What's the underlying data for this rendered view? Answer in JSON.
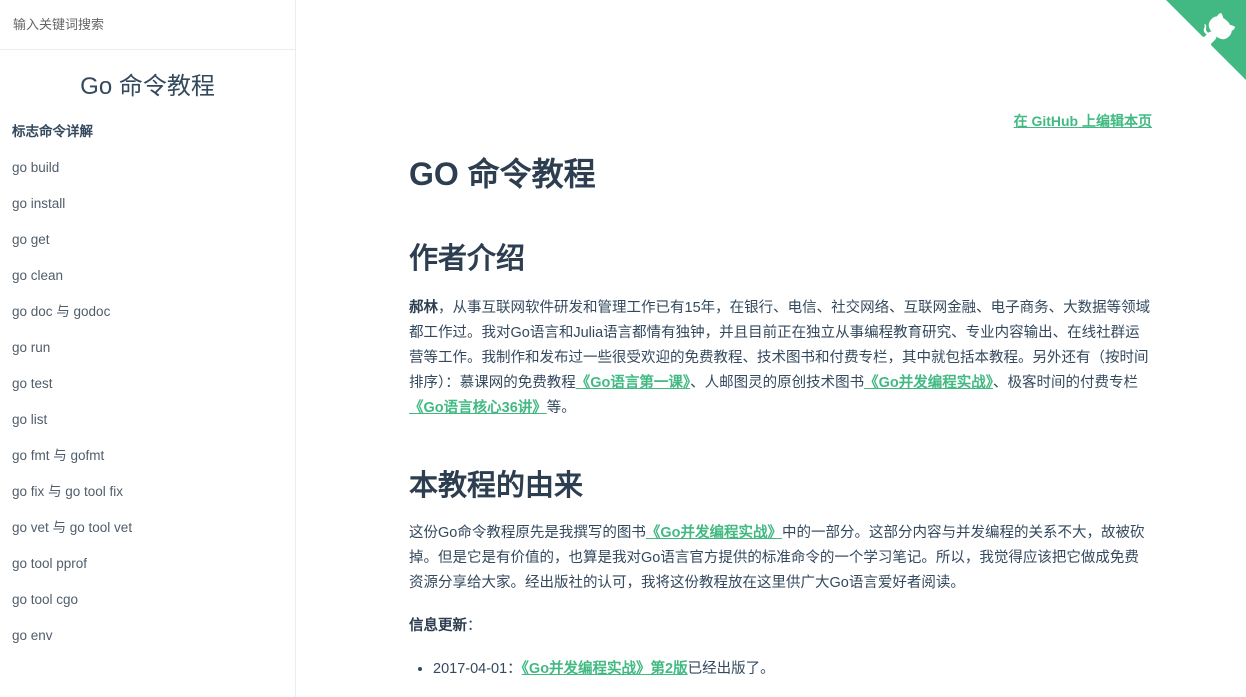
{
  "sidebar": {
    "search_placeholder": "输入关键词搜索",
    "app_name": "Go 命令教程",
    "items": [
      "标志命令详解",
      "go build",
      "go install",
      "go get",
      "go clean",
      "go doc 与 godoc",
      "go run",
      "go test",
      "go list",
      "go fmt 与 gofmt",
      "go fix 与 go tool fix",
      "go vet 与 go tool vet",
      "go tool pprof",
      "go tool cgo",
      "go env"
    ]
  },
  "corner": {
    "icon": "github-octocat-icon",
    "color": "#42b983"
  },
  "content": {
    "edit_link": "在 GitHub 上编辑本页",
    "title": "GO 命令教程",
    "section1": {
      "heading": "作者介绍",
      "author": "郝林",
      "p1_a": "，从事互联网软件研发和管理工作已有15年，在银行、电信、社交网络、互联网金融、电子商务、大数据等领域都工作过。我对Go语言和Julia语言都情有独钟，并且目前正在独立从事编程教育研究、专业内容输出、在线社群运营等工作。我制作和发布过一些很受欢迎的免费教程、技术图书和付费专栏，其中就包括本教程。另外还有（按时间排序）：慕课网的免费教程",
      "link1": "《Go语言第一课》",
      "p1_b": "、人邮图灵的原创技术图书",
      "link2": "《Go并发编程实战》",
      "p1_c": "、极客时间的付费专栏",
      "link3": "《Go语言核心36讲》",
      "p1_d": "等。"
    },
    "section2": {
      "heading": "本教程的由来",
      "p2_a": "这份Go命令教程原先是我撰写的图书",
      "link4": "《Go并发编程实战》",
      "p2_b": "中的一部分。这部分内容与并发编程的关系不大，故被砍掉。但是它是有价值的，也算是我对Go语言官方提供的标准命令的一个学习笔记。所以，我觉得应该把它做成免费资源分享给大家。经出版社的认可，我将这份教程放在这里供广大Go语言爱好者阅读。",
      "info_label": "信息更新",
      "info_colon": "：",
      "updates": [
        {
          "date": "2017-04-01：",
          "link": "《Go并发编程实战》第2版",
          "tail": "已经出版了。"
        }
      ]
    },
    "accent_color": "#42b983"
  }
}
